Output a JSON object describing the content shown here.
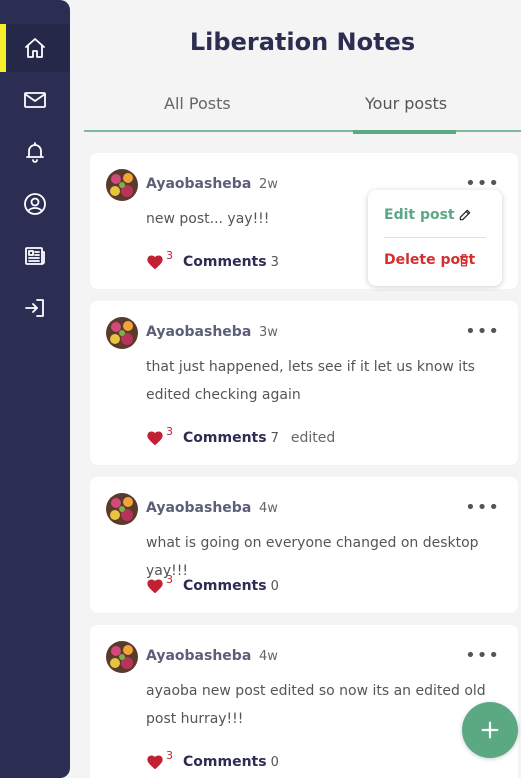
{
  "app": {
    "title": "Liberation Notes"
  },
  "tabs": [
    {
      "label": "All Posts",
      "active": false
    },
    {
      "label": "Your posts",
      "active": true
    }
  ],
  "sidebar": {
    "items": [
      {
        "icon": "home-icon",
        "active": true
      },
      {
        "icon": "mail-icon",
        "active": false
      },
      {
        "icon": "bell-icon",
        "active": false
      },
      {
        "icon": "user-circle-icon",
        "active": false
      },
      {
        "icon": "newspaper-icon",
        "active": false
      },
      {
        "icon": "logout-icon",
        "active": false
      }
    ]
  },
  "posts": [
    {
      "author": "Ayaobasheba",
      "time": "2w",
      "body": "new post... yay!!!",
      "likes": "3",
      "comments_label": "Comments",
      "comments": "3",
      "edited": ""
    },
    {
      "author": "Ayaobasheba",
      "time": "3w",
      "body": "that just happened, lets see if it let us know its edited checking again",
      "likes": "3",
      "comments_label": "Comments",
      "comments": "7",
      "edited": "edited"
    },
    {
      "author": "Ayaobasheba",
      "time": "4w",
      "body": "what is going on everyone changed on desktop yay!!!",
      "likes": "3",
      "comments_label": "Comments",
      "comments": "0",
      "edited": ""
    },
    {
      "author": "Ayaobasheba",
      "time": "4w",
      "body": "ayaoba new post edited so now its an edited old post hurray!!!",
      "likes": "3",
      "comments_label": "Comments",
      "comments": "0",
      "edited": ""
    }
  ],
  "menu": {
    "edit_label": "Edit post",
    "delete_label": "Delete post"
  },
  "colors": {
    "sidebar": "#2b2d52",
    "accent": "#5aa983",
    "active_indicator": "#f6ee2a",
    "heart": "#c22134",
    "danger": "#d32f2f"
  }
}
